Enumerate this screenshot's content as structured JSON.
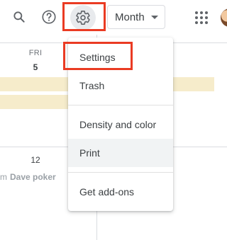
{
  "toolbar": {
    "search_icon": "search-icon",
    "help_icon": "help-icon",
    "settings_icon": "gear-icon",
    "view_select": {
      "selected": "Month"
    },
    "apps_icon": "apps-grid-icon"
  },
  "calendar": {
    "day_name": "FRI",
    "day_number": "5",
    "next_week_day_number": "12",
    "event_time_fragment": "m",
    "event_title": "Dave poker",
    "event_color": "#f6eccb"
  },
  "settings_menu": {
    "items": [
      {
        "label": "Settings"
      },
      {
        "label": "Trash"
      },
      {
        "label": "Density and color"
      },
      {
        "label": "Print"
      },
      {
        "label": "Get add-ons"
      }
    ]
  },
  "annotations": {
    "highlight_color": "#ea3b23"
  }
}
